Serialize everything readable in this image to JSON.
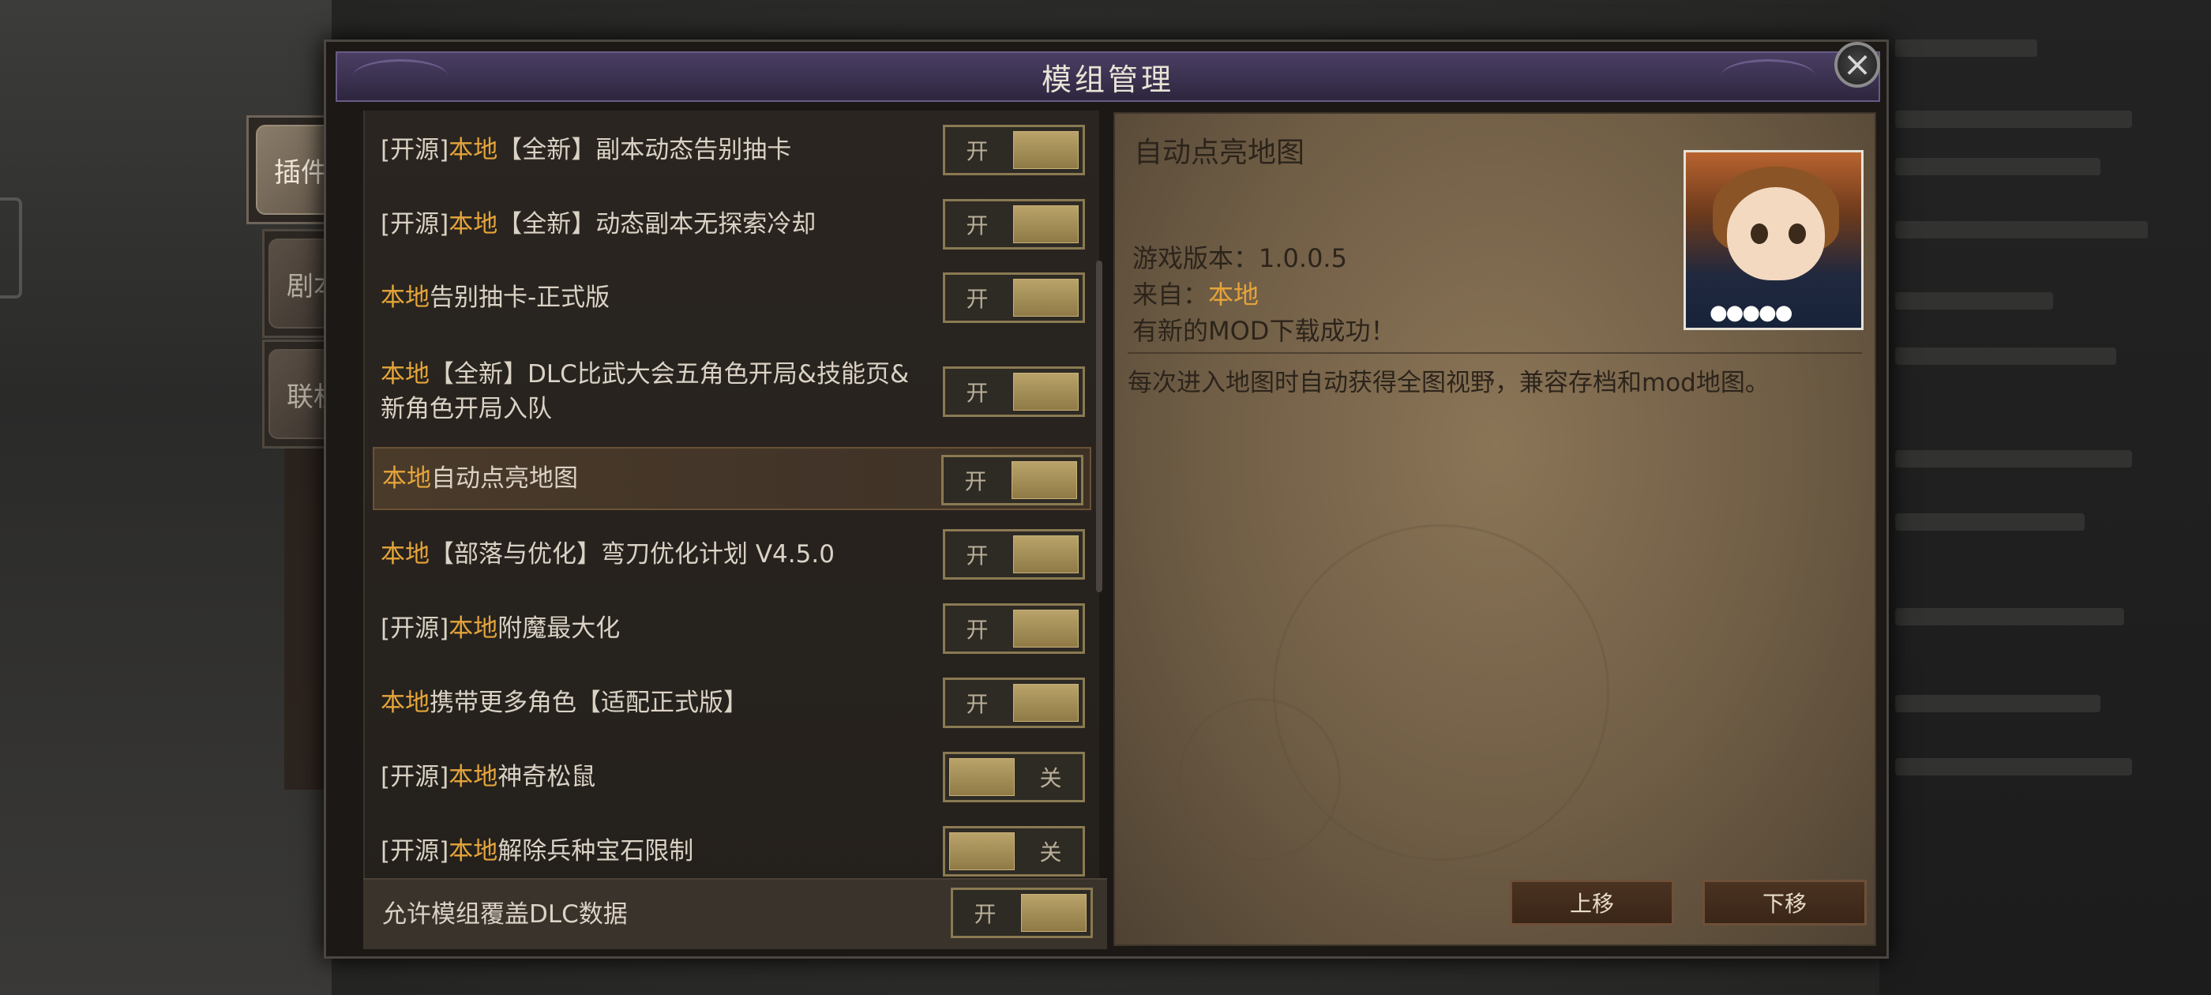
{
  "dialog": {
    "title": "模组管理",
    "close_icon": "close-icon"
  },
  "tabs": [
    {
      "label": "插件",
      "active": true
    },
    {
      "label": "剧本",
      "active": false
    },
    {
      "label": "联机",
      "active": false
    }
  ],
  "mods": [
    {
      "prefix": "[开源]",
      "source": "本地",
      "name": "【全新】副本动态告别抽卡",
      "toggle": "开",
      "on": true
    },
    {
      "prefix": "[开源]",
      "source": "本地",
      "name": "【全新】动态副本无探索冷却",
      "toggle": "开",
      "on": true
    },
    {
      "prefix": "",
      "source": "本地",
      "name": "告别抽卡-正式版",
      "toggle": "开",
      "on": true
    },
    {
      "prefix": "",
      "source": "本地",
      "name": "【全新】DLC比武大会五角色开局&技能页&新角色开局入队",
      "toggle": "开",
      "on": true
    },
    {
      "prefix": "",
      "source": "本地",
      "name": "自动点亮地图",
      "toggle": "开",
      "on": true,
      "selected": true
    },
    {
      "prefix": "",
      "source": "本地",
      "name": "【部落与优化】弯刀优化计划 V4.5.0",
      "toggle": "开",
      "on": true
    },
    {
      "prefix": "[开源]",
      "source": "本地",
      "name": "附魔最大化",
      "toggle": "开",
      "on": true
    },
    {
      "prefix": "",
      "source": "本地",
      "name": "携带更多角色【适配正式版】",
      "toggle": "开",
      "on": true
    },
    {
      "prefix": "[开源]",
      "source": "本地",
      "name": "神奇松鼠",
      "toggle": "关",
      "on": false
    },
    {
      "prefix": "[开源]",
      "source": "本地",
      "name": "解除兵种宝石限制",
      "toggle": "关",
      "on": false
    }
  ],
  "dlc_override": {
    "label": "允许模组覆盖DLC数据",
    "toggle": "开",
    "on": true
  },
  "detail": {
    "title": "自动点亮地图",
    "version_label": "游戏版本：1.0.0.5",
    "from_label": "来自：",
    "from_value": "本地",
    "status": "有新的MOD下载成功！",
    "description": "每次进入地图时自动获得全图视野，兼容存档和mod地图。",
    "move_up": "上移",
    "move_down": "下移"
  },
  "colors": {
    "highlight": "#e4a43a",
    "title_bar": "#3b3150",
    "toggle_knob": "#a58f58"
  }
}
